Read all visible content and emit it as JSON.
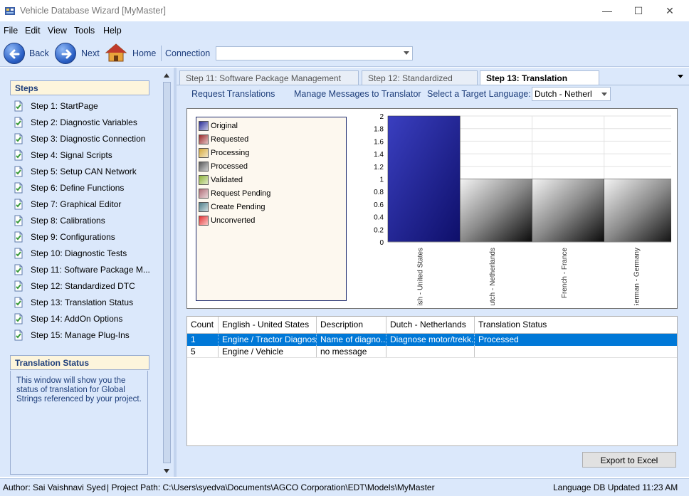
{
  "window": {
    "title": "Vehicle Database Wizard  [MyMaster]"
  },
  "menu": [
    "File",
    "Edit",
    "View",
    "Tools",
    "Help"
  ],
  "toolbar": {
    "back": "Back",
    "next": "Next",
    "home": "Home",
    "connection_label": "Connection",
    "connection_value": ""
  },
  "sidebar": {
    "steps_header": "Steps",
    "steps": [
      "Step 1: StartPage",
      "Step 2: Diagnostic Variables",
      "Step 3: Diagnostic Connection",
      "Step 4: Signal Scripts",
      "Step 5: Setup CAN Network",
      "Step 6: Define Functions",
      "Step 7: Graphical Editor",
      "Step 8: Calibrations",
      "Step 9: Configurations",
      "Step 10: Diagnostic Tests",
      "Step 11:  Software Package M...",
      "Step 12: Standardized DTC",
      "Step 13: Translation Status",
      "Step 14: AddOn Options",
      "Step 15: Manage Plug-Ins"
    ],
    "info_header": "Translation Status",
    "info_text": "This window will show you the status of translation for Global Strings referenced by your project."
  },
  "tabs": [
    "Step 11: Software Package Management",
    "Step 12: Standardized DTC",
    "Step 13: Translation Status"
  ],
  "subbar": {
    "request": "Request Translations",
    "manage": "Manage Messages to Translator",
    "select_label": "Select a Target Language:",
    "selected_language": "Dutch - Netherl"
  },
  "legend": [
    {
      "label": "Original",
      "color": "#2b2f9a"
    },
    {
      "label": "Requested",
      "color": "#9b2a2a"
    },
    {
      "label": "Processing",
      "color": "#d6a93a"
    },
    {
      "label": "Processed",
      "color": "#5a5a5a"
    },
    {
      "label": "Validated",
      "color": "#8fb43a"
    },
    {
      "label": "Request Pending",
      "color": "#b06d78"
    },
    {
      "label": "Create Pending",
      "color": "#4f7f8a"
    },
    {
      "label": "Unconverted",
      "color": "#e53333"
    }
  ],
  "chart_data": {
    "type": "bar",
    "categories": [
      "English - United States",
      "Dutch - Netherlands",
      "French - France",
      "German - Germany"
    ],
    "series": [
      {
        "name": "Original",
        "values": [
          2,
          0,
          0,
          0
        ]
      },
      {
        "name": "Processed",
        "values": [
          0,
          1,
          1,
          1
        ]
      }
    ],
    "yticks": [
      "0",
      "0.2",
      "0.4",
      "0.6",
      "0.8",
      "1",
      "1.2",
      "1.4",
      "1.6",
      "1.8",
      "2"
    ],
    "ylim": [
      0,
      2
    ],
    "grid": true,
    "legend": "left"
  },
  "grid": {
    "columns": [
      "Count",
      "English - United States",
      "Description",
      "Dutch - Netherlands",
      "Translation Status"
    ],
    "rows": [
      [
        "1",
        "Engine / Tractor Diagnos...",
        "Name of diagno...",
        "Diagnose motor/trekk...",
        "Processed"
      ],
      [
        "5",
        "Engine / Vehicle",
        "no message",
        "",
        ""
      ]
    ]
  },
  "export_button": "Export to Excel",
  "status": {
    "author": "Author: Sai Vaishnavi Syed",
    "path": "| Project Path: C:\\Users\\syedva\\Documents\\AGCO Corporation\\EDT\\Models\\MyMaster",
    "updated": "Language DB Updated 11:23 AM"
  }
}
